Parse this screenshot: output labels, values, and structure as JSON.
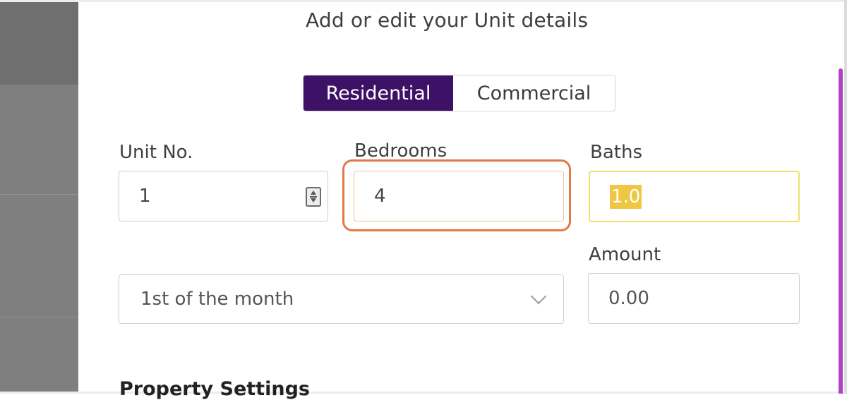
{
  "modal": {
    "title": "Add or edit your Unit details",
    "property_type_toggle": {
      "options": [
        "Residential",
        "Commercial"
      ],
      "selected": "Residential"
    }
  },
  "form": {
    "unit_no": {
      "label": "Unit No.",
      "value": "1"
    },
    "bedrooms": {
      "label": "Bedrooms",
      "value": "4"
    },
    "baths": {
      "label": "Baths",
      "value": "1.0"
    },
    "due_day": {
      "selected": "1st of the month"
    },
    "amount": {
      "label": "Amount",
      "value": "0.00"
    }
  },
  "sections": {
    "property_settings": "Property Settings"
  },
  "colors": {
    "accent_purple": "#3d1165",
    "highlight_orange": "#e07b45",
    "selection_yellow": "#efc743",
    "scrollbar_magenta": "#b043c4"
  }
}
